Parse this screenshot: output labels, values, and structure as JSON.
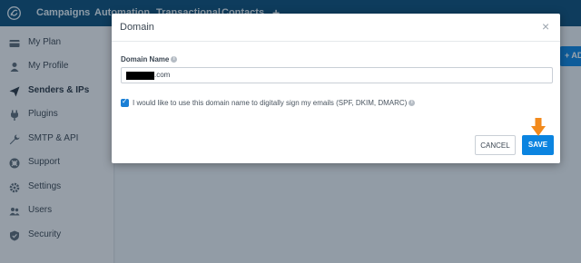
{
  "topnav": {
    "items": [
      "Campaigns",
      "Automation",
      "Transactional",
      "Contacts"
    ],
    "add_icon": "plus-icon"
  },
  "sidebar": {
    "items": [
      {
        "label": "My Plan",
        "icon": "card-icon"
      },
      {
        "label": "My Profile",
        "icon": "user-icon"
      },
      {
        "label": "Senders & IPs",
        "icon": "send-icon",
        "active": true
      },
      {
        "label": "Plugins",
        "icon": "plug-icon"
      },
      {
        "label": "SMTP & API",
        "icon": "wrench-icon"
      },
      {
        "label": "Support",
        "icon": "lifebuoy-icon"
      },
      {
        "label": "Settings",
        "icon": "gear-icon"
      },
      {
        "label": "Users",
        "icon": "users-icon"
      },
      {
        "label": "Security",
        "icon": "shield-icon"
      }
    ]
  },
  "main": {
    "add_button_label": "+ ADD"
  },
  "modal": {
    "title": "Domain",
    "field_label": "Domain Name",
    "domain_value_suffix": ".com",
    "checkbox_checked": true,
    "checkbox_label": "I would like to use this domain name to digitally sign my emails (SPF, DKIM, DMARC)",
    "cancel_label": "CANCEL",
    "save_label": "SAVE"
  },
  "colors": {
    "nav_bg": "#0b4d78",
    "primary": "#0b84e0",
    "arrow": "#f28a1c"
  }
}
